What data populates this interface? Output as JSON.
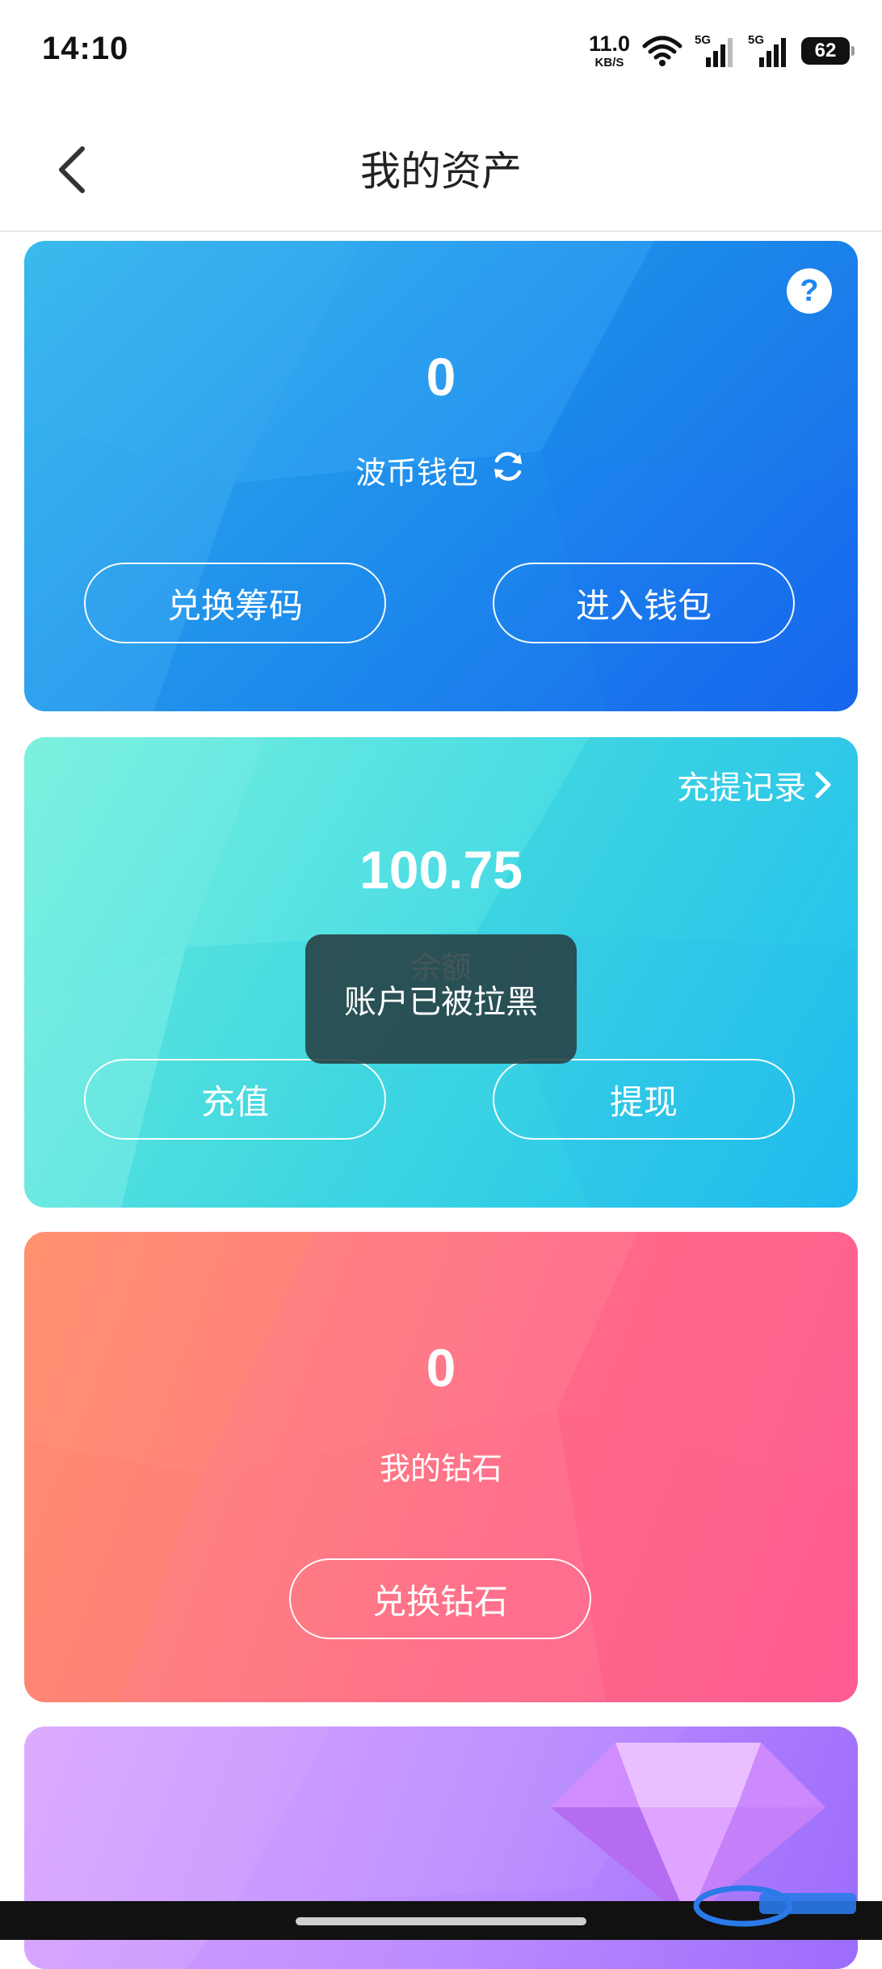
{
  "status_bar": {
    "time": "14:10",
    "net_speed_value": "11.0",
    "net_speed_unit": "KB/S",
    "sim1_tag": "5G",
    "sim2_tag": "5G",
    "battery": "62"
  },
  "header": {
    "title": "我的资产"
  },
  "wallet_card": {
    "amount": "0",
    "label": "波币钱包",
    "help_icon": "?",
    "exchange_button": "兑换筹码",
    "enter_button": "进入钱包"
  },
  "balance_card": {
    "records_link": "充提记录",
    "amount": "100.75",
    "label": "余额",
    "recharge_button": "充值",
    "withdraw_button": "提现"
  },
  "diamond_card": {
    "amount": "0",
    "label": "我的钻石",
    "exchange_button": "兑换钻石"
  },
  "toast": {
    "message": "账户已被拉黑"
  },
  "colors": {
    "wallet_card": "#1f8ff0",
    "balance_card": "#42dbe3",
    "diamond_card": "#ff6d86",
    "purple_card": "#bb8cff"
  }
}
